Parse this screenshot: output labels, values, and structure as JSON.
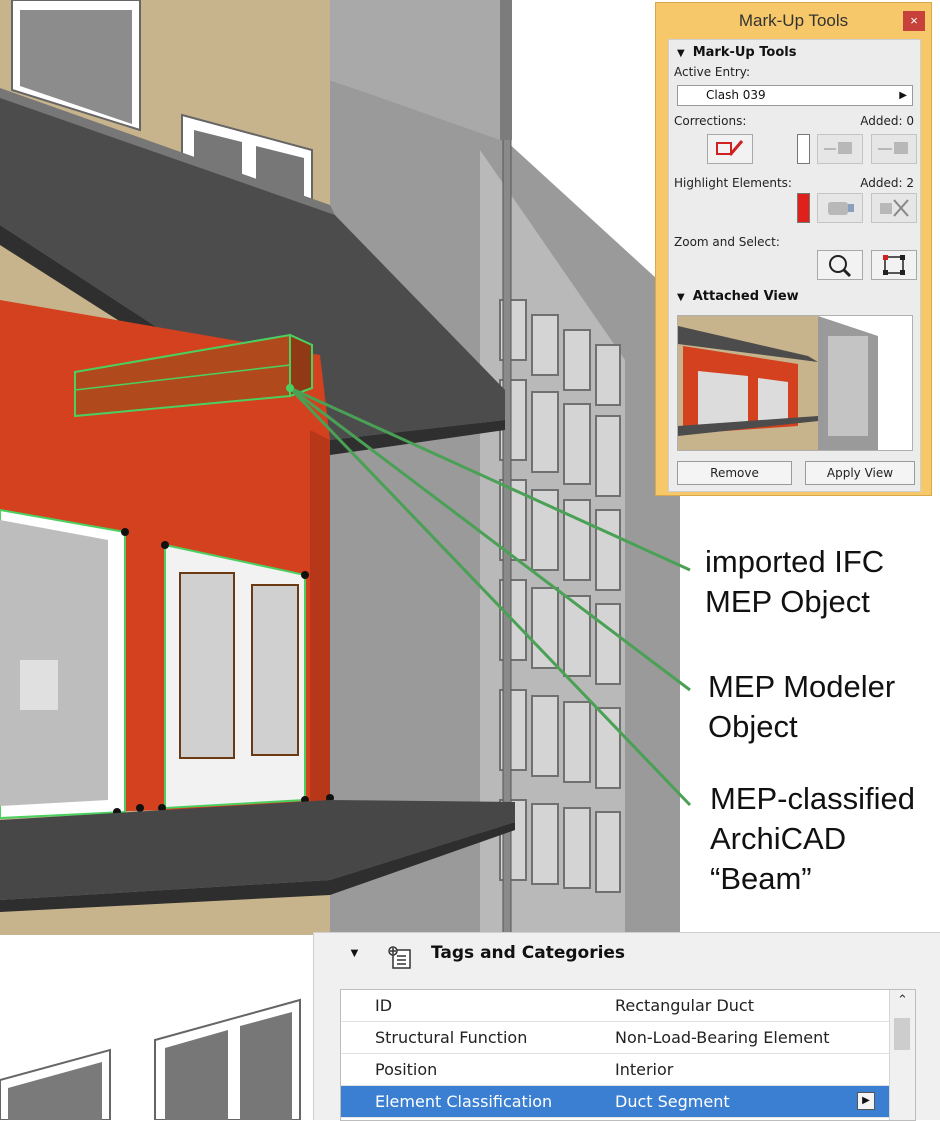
{
  "callouts": {
    "ifc": "imported IFC\nMEP Object",
    "modeler": "MEP Modeler\nObject",
    "beam": "MEP-classified\nArchiCAD\n“Beam”"
  },
  "markup": {
    "window_title": "Mark-Up Tools",
    "close_glyph": "×",
    "section1": "Mark-Up Tools",
    "active_entry_label": "Active Entry:",
    "active_entry_value": "Clash 039",
    "corrections_label": "Corrections:",
    "corrections_added": "Added: 0",
    "highlight_label": "Highlight Elements:",
    "highlight_added": "Added: 2",
    "zoom_label": "Zoom and Select:",
    "section2": "Attached View",
    "remove_button": "Remove",
    "apply_button": "Apply View",
    "highlight_color": "#e0201a",
    "panel_color": "#f6c86a"
  },
  "tags": {
    "title": "Tags and Categories",
    "rows": [
      {
        "key": "ID",
        "value": "Rectangular Duct"
      },
      {
        "key": "Structural Function",
        "value": "Non-Load-Bearing Element"
      },
      {
        "key": "Position",
        "value": "Interior"
      },
      {
        "key": "Element Classification",
        "value": "Duct Segment"
      }
    ],
    "selected_color": "#3b7fd3"
  },
  "scene": {
    "wall_color": "#c8b48c",
    "highlight_wall_color": "#d3411f",
    "duct_color": "#b04a1c",
    "leader_color": "#4aa055"
  }
}
